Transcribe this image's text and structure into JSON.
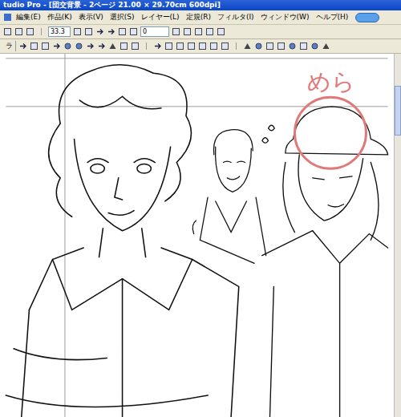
{
  "window": {
    "title": "tudio Pro - [団交背景 - 2ページ 21.00 × 29.70cm 600dpi]"
  },
  "menu": [
    "編集(E)",
    "作品(K)",
    "表示(V)",
    "選択(S)",
    "レイヤー(L)",
    "定規(R)",
    "フィルタ(I)",
    "ウィンドウ(W)",
    "ヘルプ(H)"
  ],
  "toolbar": {
    "zoom": "33.3",
    "angle": "0"
  },
  "panel_tab": {
    "label": "ラ"
  },
  "canvas": {
    "annotation": {
      "text": "めら",
      "color": "#e07a7a"
    }
  }
}
